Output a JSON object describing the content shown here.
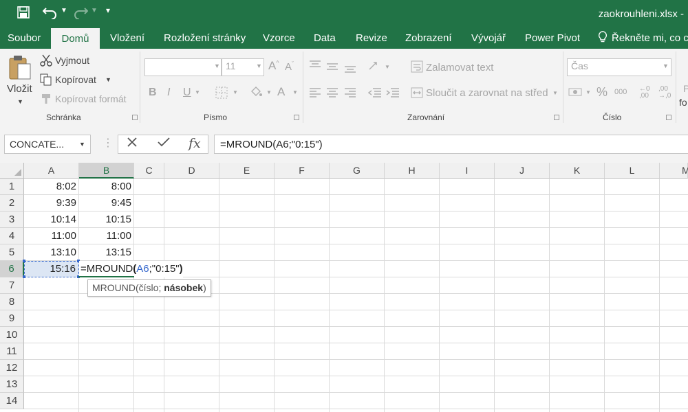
{
  "window": {
    "title": "zaokrouhleni.xlsx -"
  },
  "menu": {
    "tabs": [
      "Soubor",
      "Domů",
      "Vložení",
      "Rozložení stránky",
      "Vzorce",
      "Data",
      "Revize",
      "Zobrazení",
      "Vývojář",
      "Power Pivot"
    ],
    "tell_me": "Řekněte mi, co c"
  },
  "ribbon": {
    "clipboard": {
      "paste": "Vložit",
      "cut": "Vyjmout",
      "copy": "Kopírovat",
      "format_painter": "Kopírovat formát",
      "group": "Schránka"
    },
    "font": {
      "size": "11",
      "group": "Písmo"
    },
    "alignment": {
      "wrap": "Zalamovat text",
      "merge": "Sloučit a zarovnat na střed",
      "group": "Zarovnání"
    },
    "number": {
      "format": "Čas",
      "group": "Číslo",
      "percent": "%",
      "thousands": "000",
      "inc_decimal": "←0\n,00",
      "dec_decimal": ",00\n→,0"
    },
    "cut_off": {
      "line1": "P",
      "line2": "fo"
    }
  },
  "formula_bar": {
    "name_box": "CONCATE...",
    "fx": "fx",
    "formula": "=MROUND(A6;\"0:15\")"
  },
  "grid": {
    "columns": [
      "A",
      "B",
      "C",
      "D",
      "E",
      "F",
      "G",
      "H",
      "I",
      "J",
      "K",
      "L",
      "M"
    ],
    "rows": [
      "1",
      "2",
      "3",
      "4",
      "5",
      "6",
      "7",
      "8",
      "9",
      "10",
      "11",
      "12",
      "13",
      "14"
    ],
    "colA": [
      "8:02",
      "9:39",
      "10:14",
      "11:00",
      "13:10",
      "15:16"
    ],
    "colB": [
      "8:00",
      "9:45",
      "10:15",
      "11:00",
      "13:15"
    ],
    "editing": {
      "func": "=MROUND",
      "open": "(",
      "ref": "A6",
      "rest": ";\"0:15\"",
      "close": ")"
    },
    "tooltip": {
      "func": "MROUND",
      "open": "(",
      "arg1": "číslo; ",
      "arg2": "násobek",
      "close": ")"
    }
  },
  "colors": {
    "brand": "#217346",
    "ref_blue": "#3366cc",
    "ref_fill": "#dce6f4"
  }
}
